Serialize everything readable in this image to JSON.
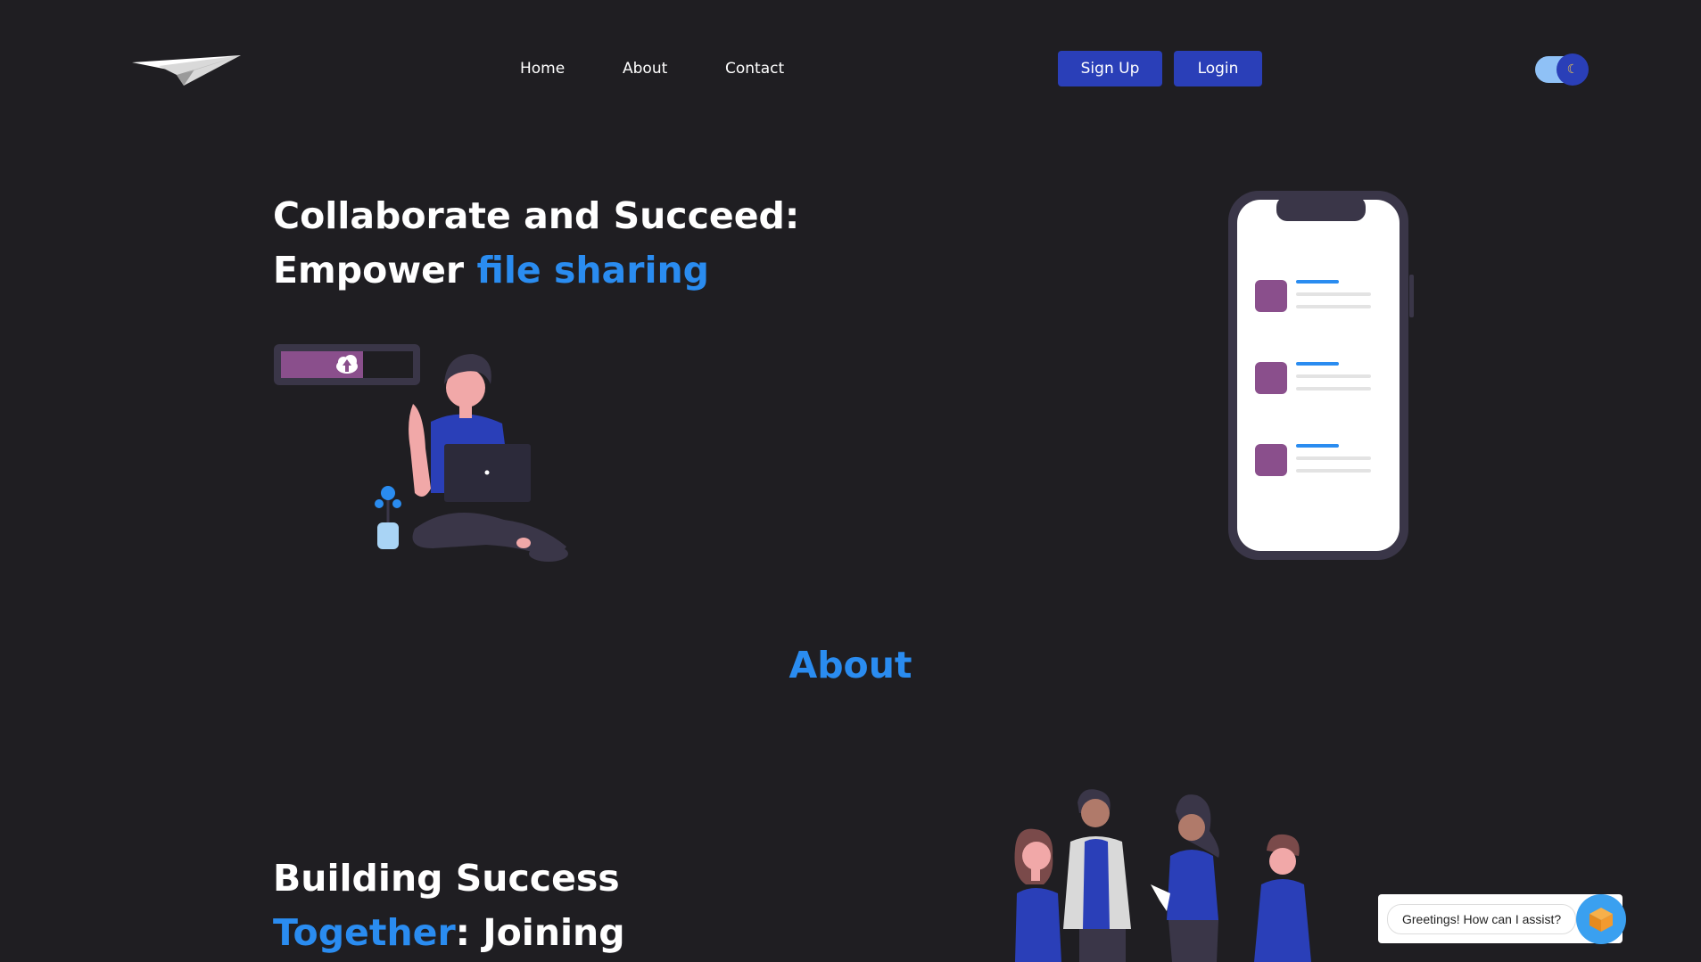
{
  "header": {
    "logo_icon": "paper-plane-icon",
    "nav": [
      {
        "label": "Home"
      },
      {
        "label": "About"
      },
      {
        "label": "Contact"
      }
    ],
    "signup_label": "Sign Up",
    "login_label": "Login",
    "theme_toggle_icon": "moon-icon",
    "theme_toggle_state": "dark"
  },
  "hero": {
    "title_line1": "Collaborate and Succeed:",
    "title_line2_plain": "Empower ",
    "title_line2_accent": "file sharing",
    "illustration_left": "person-uploading-file-illustration",
    "illustration_right": "phone-file-list-illustration"
  },
  "about": {
    "section_heading": "About",
    "title_line1": "Building Success",
    "title_line2_accent": "Together",
    "title_line2_plain": ": Joining",
    "illustration": "team-people-illustration"
  },
  "chat": {
    "greeting": "Greetings! How can I assist?",
    "avatar_icon": "cube-icon"
  },
  "colors": {
    "background": "#1f1e22",
    "accent": "#2a8cf0",
    "button": "#2a3fb8",
    "purple": "#8a4f8c"
  }
}
